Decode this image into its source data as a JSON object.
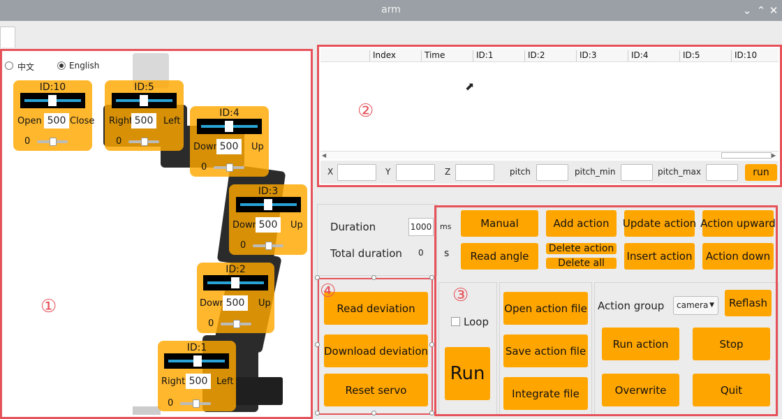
{
  "window": {
    "title": "arm",
    "min_icon": "chevron-down",
    "max_icon": "chevron-up",
    "close_icon": "close"
  },
  "language": {
    "chinese": "中文",
    "english": "English",
    "selected": "English"
  },
  "servos": [
    {
      "id": "ID:10",
      "value": "500",
      "left_label": "Open",
      "right_label": "Close",
      "offset": "0"
    },
    {
      "id": "ID:5",
      "value": "500",
      "left_label": "Right",
      "right_label": "Left",
      "offset": "0"
    },
    {
      "id": "ID:4",
      "value": "500",
      "left_label": "Down",
      "right_label": "Up",
      "offset": "0"
    },
    {
      "id": "ID:3",
      "value": "500",
      "left_label": "Down",
      "right_label": "Up",
      "offset": "0"
    },
    {
      "id": "ID:2",
      "value": "500",
      "left_label": "Down",
      "right_label": "Up",
      "offset": "0"
    },
    {
      "id": "ID:1",
      "value": "500",
      "left_label": "Right",
      "right_label": "Left",
      "offset": "0"
    }
  ],
  "table": {
    "columns": [
      "Index",
      "Time",
      "ID:1",
      "ID:2",
      "ID:3",
      "ID:4",
      "ID:5",
      "ID:10"
    ]
  },
  "coords": {
    "x": "X",
    "y": "Y",
    "z": "Z",
    "pitch": "pitch",
    "pitch_min": "pitch_min",
    "pitch_max": "pitch_max",
    "run": "run"
  },
  "duration": {
    "label": "Duration",
    "value": "1000",
    "unit": "ms",
    "total_label": "Total duration",
    "total_value": "0",
    "total_unit": "s"
  },
  "actions": {
    "manual": "Manual",
    "add": "Add action",
    "update": "Update action",
    "upward": "Action upward",
    "read_angle": "Read angle",
    "delete": "Delete action",
    "delete_all": "Delete all",
    "insert": "Insert action",
    "down": "Action down"
  },
  "deviation": {
    "read": "Read deviation",
    "download": "Download deviation",
    "reset": "Reset servo"
  },
  "run_panel": {
    "loop": "Loop",
    "run": "Run"
  },
  "files": {
    "open": "Open action file",
    "save": "Save action file",
    "integrate": "Integrate file"
  },
  "group": {
    "label": "Action group",
    "selected": "camera",
    "refresh": "Reflash",
    "run": "Run action",
    "stop": "Stop",
    "overwrite": "Overwrite",
    "quit": "Quit"
  },
  "annotations": [
    "①",
    "②",
    "③",
    "④"
  ],
  "colors": {
    "accent": "#ffa500",
    "annotation": "#e6525a",
    "slider": "#29a3d6"
  }
}
